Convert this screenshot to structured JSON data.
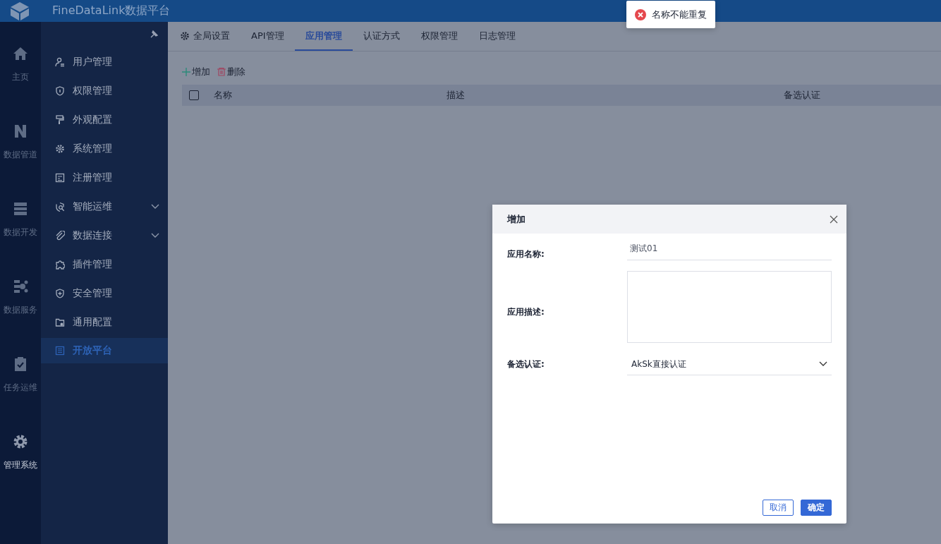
{
  "header": {
    "title": "FineDataLink数据平台"
  },
  "rail": [
    {
      "label": "主页",
      "selected": false
    },
    {
      "label": "数据管道",
      "selected": false
    },
    {
      "label": "数据开发",
      "selected": false
    },
    {
      "label": "数据服务",
      "selected": false
    },
    {
      "label": "任务运维",
      "selected": false
    },
    {
      "label": "管理系统",
      "selected": true
    }
  ],
  "sidebar": {
    "items": [
      {
        "label": "用户管理",
        "selected": false,
        "expandable": false
      },
      {
        "label": "权限管理",
        "selected": false,
        "expandable": false
      },
      {
        "label": "外观配置",
        "selected": false,
        "expandable": false
      },
      {
        "label": "系统管理",
        "selected": false,
        "expandable": false
      },
      {
        "label": "注册管理",
        "selected": false,
        "expandable": false
      },
      {
        "label": "智能运维",
        "selected": false,
        "expandable": true
      },
      {
        "label": "数据连接",
        "selected": false,
        "expandable": true
      },
      {
        "label": "插件管理",
        "selected": false,
        "expandable": false
      },
      {
        "label": "安全管理",
        "selected": false,
        "expandable": false
      },
      {
        "label": "通用配置",
        "selected": false,
        "expandable": false
      },
      {
        "label": "开放平台",
        "selected": true,
        "expandable": false
      }
    ]
  },
  "tabs": [
    {
      "label": "全局设置",
      "kind": "gear",
      "selected": false
    },
    {
      "label": "API管理",
      "kind": "text",
      "selected": false
    },
    {
      "label": "应用管理",
      "kind": "text",
      "selected": true
    },
    {
      "label": "认证方式",
      "kind": "text",
      "selected": false
    },
    {
      "label": "权限管理",
      "kind": "text",
      "selected": false
    },
    {
      "label": "日志管理",
      "kind": "text",
      "selected": false
    }
  ],
  "toolbar": [
    {
      "label": "增加",
      "kind": "add"
    },
    {
      "label": "删除",
      "kind": "delete"
    }
  ],
  "table": {
    "select_all": {
      "checked": false
    },
    "columns": [
      "名称",
      "描述",
      "备选认证"
    ]
  },
  "dialog": {
    "title": "增加",
    "fields": [
      {
        "label": "应用名称:",
        "kind": "text",
        "value": "测试01"
      },
      {
        "label": "应用描述:",
        "kind": "textarea"
      },
      {
        "label": "备选认证:",
        "kind": "select",
        "value": "AkSk直接认证"
      }
    ],
    "buttons": [
      {
        "label": "取消",
        "kind": "secondary"
      },
      {
        "label": "确定",
        "kind": "primary"
      }
    ]
  },
  "toast": {
    "kind": "error",
    "message": "名称不能重复"
  }
}
